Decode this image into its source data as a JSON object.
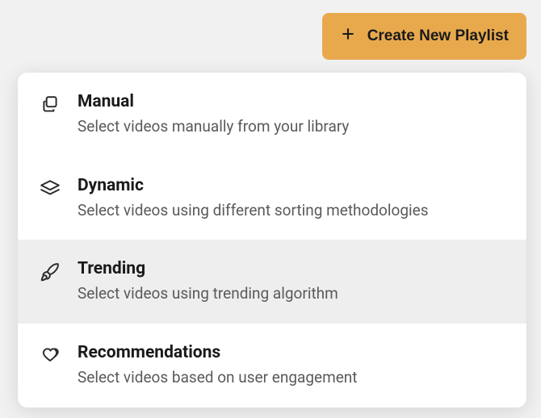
{
  "button": {
    "label": "Create New Playlist"
  },
  "options": [
    {
      "title": "Manual",
      "desc": "Select videos manually from your library",
      "icon": "copy-icon",
      "selected": false
    },
    {
      "title": "Dynamic",
      "desc": "Select videos using different sorting methodologies",
      "icon": "layers-icon",
      "selected": false
    },
    {
      "title": "Trending",
      "desc": "Select videos using trending algorithm",
      "icon": "rocket-icon",
      "selected": true
    },
    {
      "title": "Recommendations",
      "desc": "Select videos based on user engagement",
      "icon": "hearts-icon",
      "selected": false
    }
  ]
}
